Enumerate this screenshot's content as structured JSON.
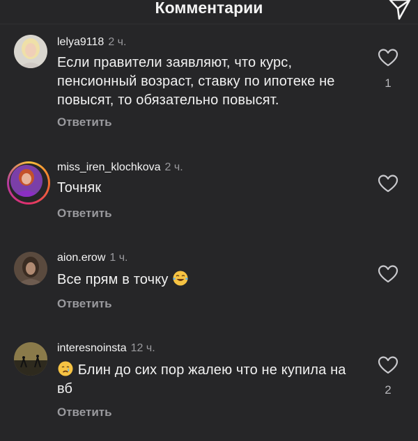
{
  "header": {
    "title": "Комментарии",
    "send_icon": "send-icon"
  },
  "comments": [
    {
      "username": "lelya9118",
      "time": "2 ч.",
      "text": "Если правители заявляют, что курс, пенсионный возраст, ставку по ипотеке не повысят, то обязательно повысят.",
      "reply_label": "Ответить",
      "likes": "1"
    },
    {
      "username": "miss_iren_klochkova",
      "time": "2 ч.",
      "text": "Точняк",
      "reply_label": "Ответить",
      "likes": ""
    },
    {
      "username": "aion.erow",
      "time": "1 ч.",
      "text": "Все прям в точку",
      "emoji": "tears-of-joy-emoji",
      "reply_label": "Ответить",
      "likes": ""
    },
    {
      "username": "interesnoinsta",
      "time": "12 ч.",
      "text": "Блин до сих пор жалею что не купила на вб",
      "emoji": "crying-face-emoji",
      "reply_label": "Ответить",
      "likes": "2"
    }
  ],
  "colors": {
    "background": "#262628",
    "text": "#f5f5f5",
    "secondary": "#9a9a9e"
  }
}
